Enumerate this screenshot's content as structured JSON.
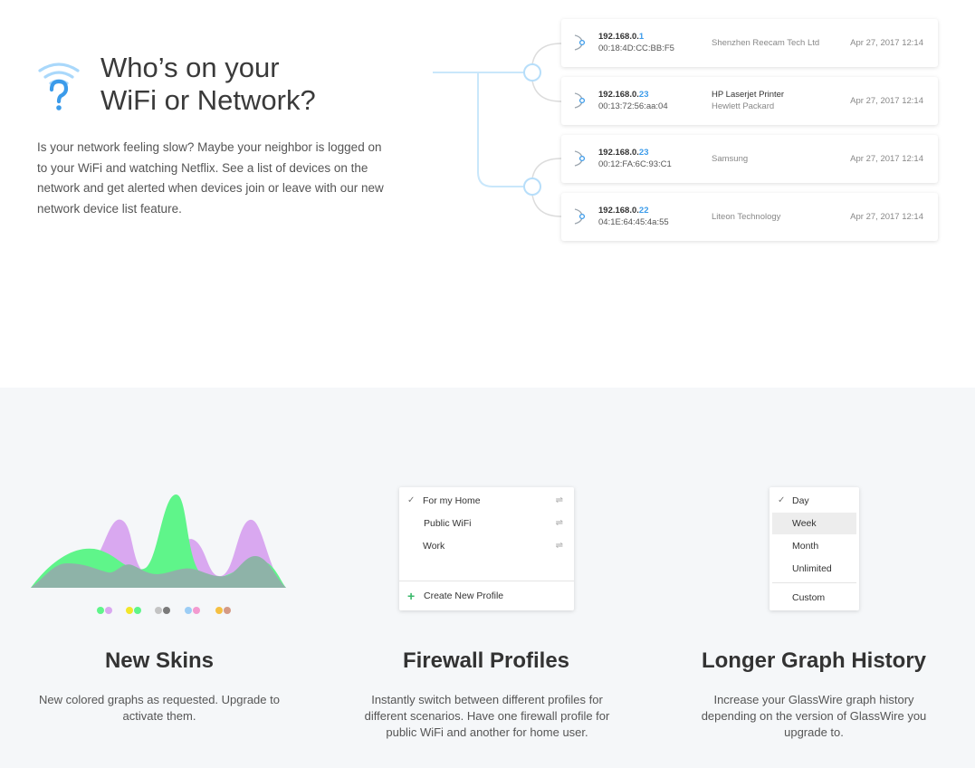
{
  "hero": {
    "title_line1": "Who’s on your",
    "title_line2": "WiFi or Network?",
    "description": "Is your network feeling slow? Maybe your neighbor is logged on to your WiFi and watching Netflix. See a list of devices on the network and get alerted when devices join or leave with our new network device list feature."
  },
  "devices": [
    {
      "ip_prefix": "192.168.0.",
      "ip_suffix": "1",
      "mac": "00:18:4D:CC:BB:F5",
      "vendor": "Shenzhen Reecam Tech Ltd",
      "vendor_sub": "",
      "date": "Apr 27, 2017 12:14"
    },
    {
      "ip_prefix": "192.168.0.",
      "ip_suffix": "23",
      "mac": "00:13:72:56:aa:04",
      "vendor": "HP Laserjet Printer",
      "vendor_sub": "Hewlett Packard",
      "date": "Apr 27, 2017 12:14"
    },
    {
      "ip_prefix": "192.168.0.",
      "ip_suffix": "23",
      "mac": "00:12:FA:6C:93:C1",
      "vendor": "Samsung",
      "vendor_sub": "",
      "date": "Apr 27, 2017 12:14"
    },
    {
      "ip_prefix": "192.168.0.",
      "ip_suffix": "22",
      "mac": "04:1E:64:45:4a:55",
      "vendor": "Liteon Technology",
      "vendor_sub": "",
      "date": "Apr 27, 2017 12:14"
    }
  ],
  "colors": {
    "accent_blue": "#3b9bea",
    "tree_line": "#c9e7fb",
    "skin_green": "#5ff58a",
    "skin_purple": "#d9a8f0",
    "skin_overlap": "#8eb3a8"
  },
  "skins_swatches": [
    [
      "#5ff58a",
      "#d9a8f0"
    ],
    [
      "#f2e62b",
      "#5ff58a"
    ],
    [
      "#c4c4c4",
      "#7a7a7a"
    ],
    [
      "#9ccdf5",
      "#f39ad0"
    ],
    [
      "#f5c042",
      "#d49a85"
    ]
  ],
  "features": [
    {
      "title": "New Skins",
      "description": "New colored graphs as requested. Upgrade to activate them."
    },
    {
      "title": "Firewall Profiles",
      "description": "Instantly switch between different profiles for different scenarios. Have one firewall profile for public WiFi and another for home user."
    },
    {
      "title": "Longer Graph History",
      "description": "Increase your GlassWire graph history depending on the version of GlassWire you upgrade to."
    }
  ],
  "firewall_profiles": {
    "items": [
      "For my Home",
      "Public WiFi",
      "Work"
    ],
    "selected": "For my Home",
    "create_label": "Create New Profile"
  },
  "graph_history": {
    "items": [
      "Day",
      "Week",
      "Month",
      "Unlimited"
    ],
    "checked": "Day",
    "highlighted": "Week",
    "custom_label": "Custom"
  }
}
